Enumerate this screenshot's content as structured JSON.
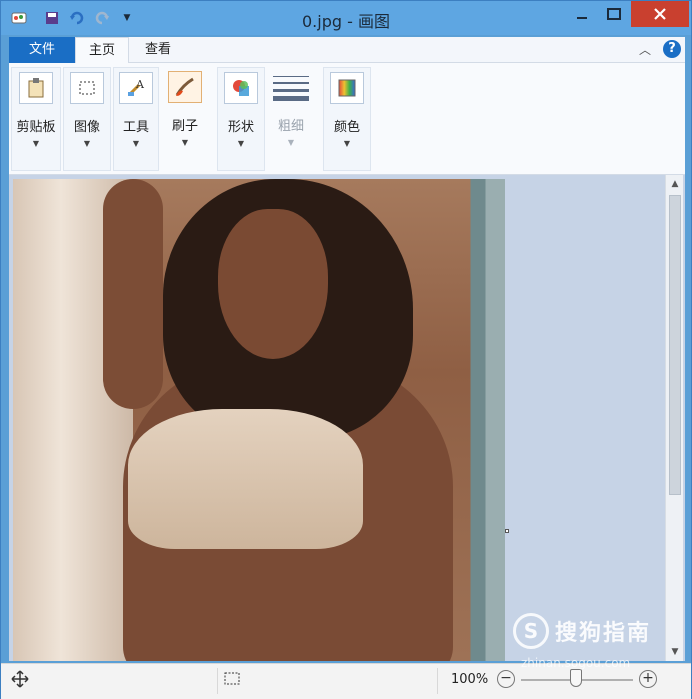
{
  "window": {
    "title": "0.jpg - 画图"
  },
  "quick_access": {
    "icons": [
      "paint-app-icon",
      "save-icon",
      "undo-icon",
      "redo-icon",
      "customize-dropdown-icon"
    ]
  },
  "ribbon": {
    "tabs": [
      {
        "label": "文件"
      },
      {
        "label": "主页"
      },
      {
        "label": "查看"
      }
    ],
    "groups": [
      {
        "label": "剪贴板"
      },
      {
        "label": "图像"
      },
      {
        "label": "工具"
      },
      {
        "label": "刷子"
      },
      {
        "label": "形状"
      },
      {
        "label": "粗细"
      },
      {
        "label": "颜色"
      }
    ]
  },
  "status": {
    "zoom": "100%"
  },
  "watermark": {
    "logo": "S",
    "text": "搜狗指南",
    "sub": "zhinan.sogou.com"
  },
  "colors": {
    "accent": "#1a6ec5",
    "titlebar": "#5ea6e2",
    "close": "#c9402f",
    "canvas_bg": "#c6d3e6"
  }
}
